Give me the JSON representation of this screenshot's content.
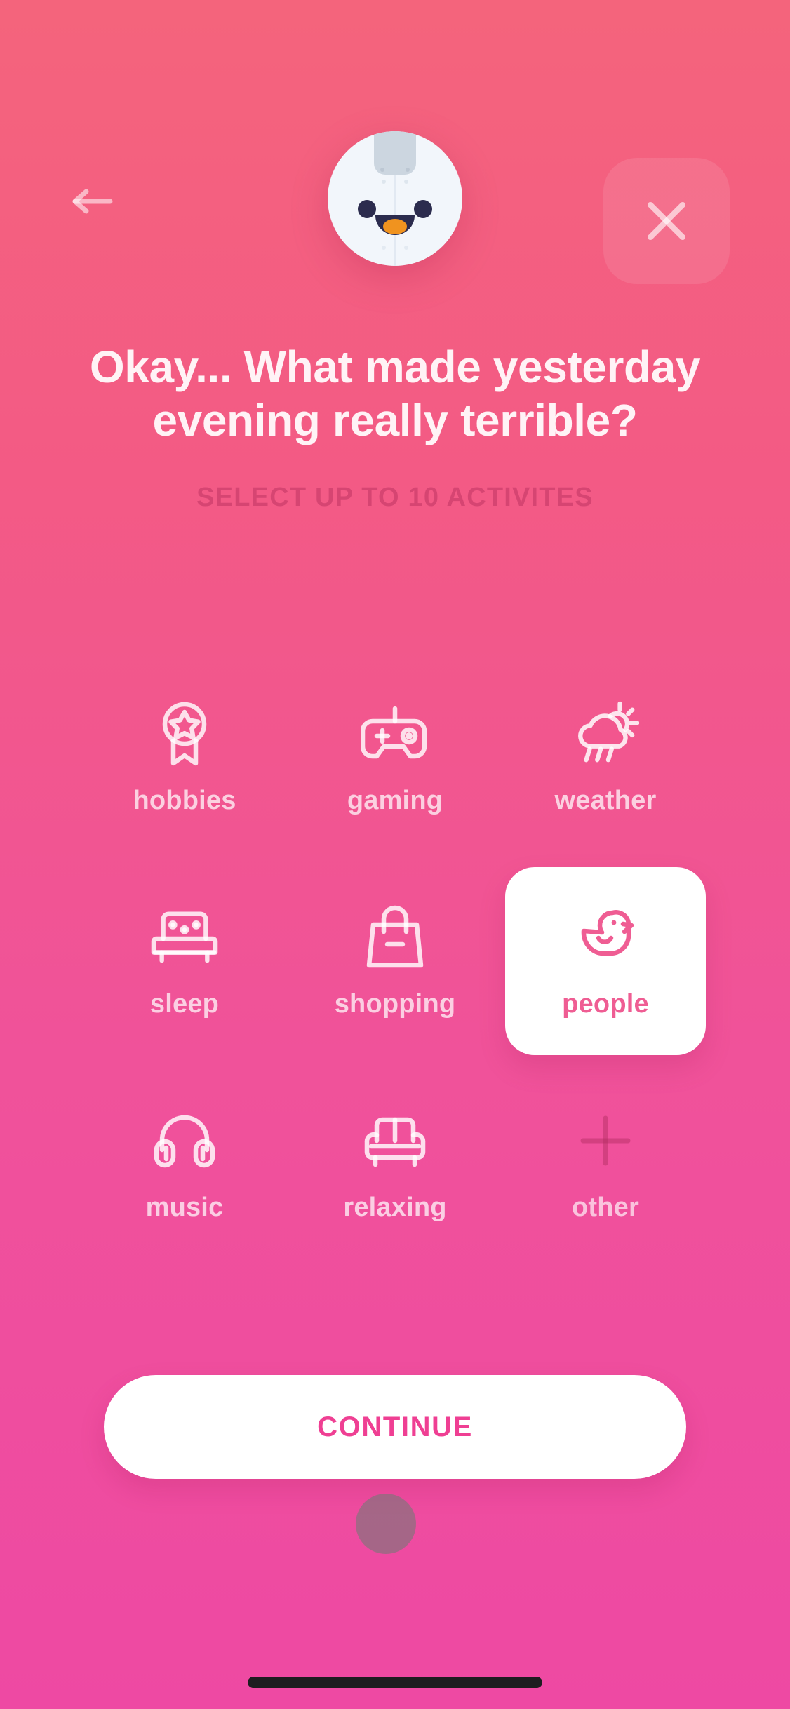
{
  "theme": {
    "bg_top": "#f4647c",
    "bg_bottom": "#ee49a3",
    "card_selected_bg": "#ffffff",
    "accent_pink": "#ef5d93",
    "continue_text_color": "#ef3f93",
    "icon_color": "rgba(255,255,255,0.80)",
    "muted_icon_color": "rgba(173,40,89,0.42)"
  },
  "header": {
    "back_icon": "arrow-left-icon",
    "close_icon": "close-x-icon",
    "mascot": "penguin-mascot-avatar"
  },
  "main": {
    "title": "Okay... What made yesterday evening really terrible?",
    "subtitle": "SELECT UP TO 10 ACTIVITES",
    "activities": [
      {
        "id": "hobbies",
        "label": "hobbies",
        "icon": "medal-award-icon",
        "selected": false
      },
      {
        "id": "gaming",
        "label": "gaming",
        "icon": "gamepad-icon",
        "selected": false
      },
      {
        "id": "weather",
        "label": "weather",
        "icon": "rain-cloud-sun-icon",
        "selected": false
      },
      {
        "id": "sleep",
        "label": "sleep",
        "icon": "bed-icon",
        "selected": false
      },
      {
        "id": "shopping",
        "label": "shopping",
        "icon": "shopping-bag-icon",
        "selected": false
      },
      {
        "id": "people",
        "label": "people",
        "icon": "rubber-duck-icon",
        "selected": true
      },
      {
        "id": "music",
        "label": "music",
        "icon": "headphones-icon",
        "selected": false
      },
      {
        "id": "relaxing",
        "label": "relaxing",
        "icon": "sofa-icon",
        "selected": false
      },
      {
        "id": "other",
        "label": "other",
        "icon": "plus-icon",
        "selected": false
      }
    ]
  },
  "footer": {
    "continue_label": "CONTINUE"
  }
}
